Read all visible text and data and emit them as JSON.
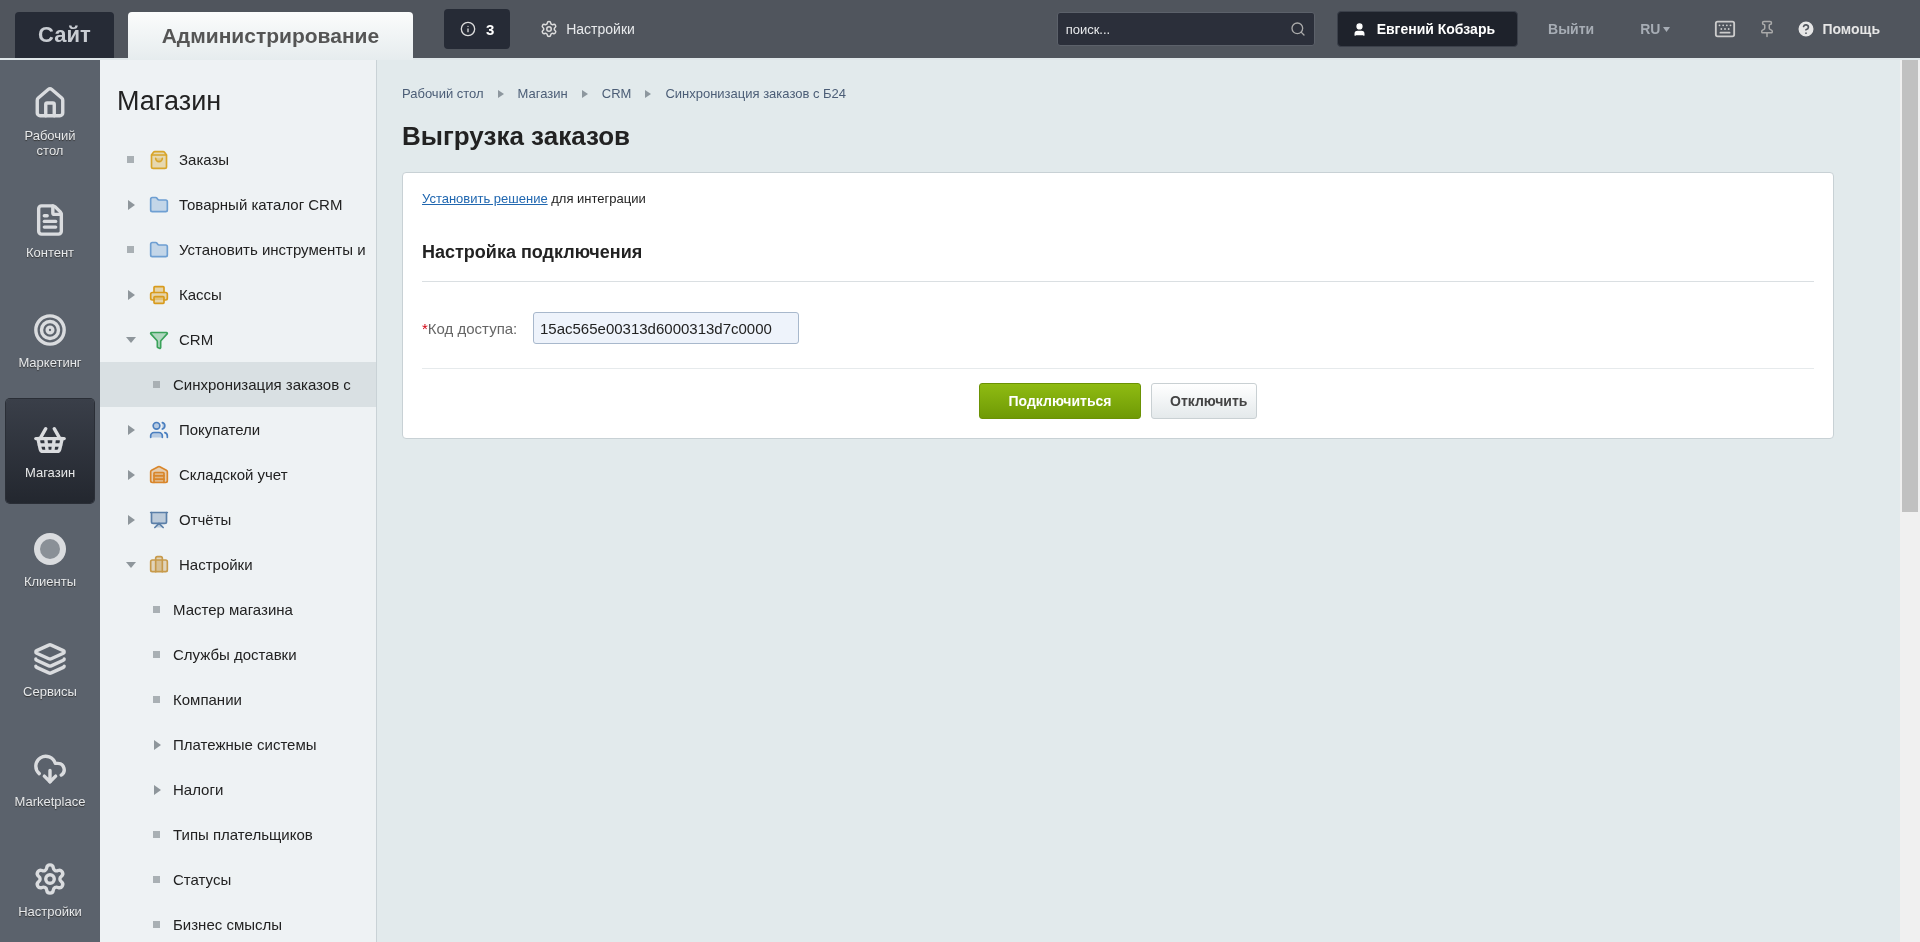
{
  "top_bar": {
    "tabs": [
      {
        "label": "Сайт",
        "selected": false
      },
      {
        "label": "Администрирование",
        "selected": true
      }
    ],
    "notifications": "3",
    "settings": "Настройки",
    "search": {
      "placeholder": "поиск..."
    },
    "user": "Евгений Кобзарь",
    "logout": "Выйти",
    "language": "RU",
    "help": "Помощь"
  },
  "rail": [
    {
      "label": "Рабочий стол",
      "selected": false
    },
    {
      "label": "Контент",
      "selected": false
    },
    {
      "label": "Маркетинг",
      "selected": false
    },
    {
      "label": "Магазин",
      "selected": true
    },
    {
      "label": "Клиенты",
      "selected": false
    },
    {
      "label": "Сервисы",
      "selected": false
    },
    {
      "label": "Marketplace",
      "selected": false
    },
    {
      "label": "Настройки",
      "selected": false
    }
  ],
  "sidebar": {
    "title": "Магазин",
    "items": [
      {
        "label": "Заказы",
        "kind": "leaf",
        "selected": false
      },
      {
        "label": "Товарный каталог CRM",
        "kind": "branch",
        "expanded": false,
        "selected": false
      },
      {
        "label": "Установить инструменты и",
        "kind": "leaf",
        "selected": false
      },
      {
        "label": "Кассы",
        "kind": "branch",
        "expanded": false,
        "selected": false
      },
      {
        "label": "CRM",
        "kind": "branch",
        "expanded": true,
        "selected": false,
        "children": [
          {
            "label": "Синхронизация заказов с",
            "kind": "leaf",
            "selected": true
          }
        ]
      },
      {
        "label": "Покупатели",
        "kind": "branch",
        "expanded": false,
        "selected": false
      },
      {
        "label": "Складской учет",
        "kind": "branch",
        "expanded": false,
        "selected": false
      },
      {
        "label": "Отчёты",
        "kind": "branch",
        "expanded": false,
        "selected": false
      },
      {
        "label": "Настройки",
        "kind": "branch",
        "expanded": true,
        "selected": false,
        "children": [
          {
            "label": "Мастер магазина",
            "kind": "leaf",
            "selected": false
          },
          {
            "label": "Службы доставки",
            "kind": "leaf",
            "selected": false
          },
          {
            "label": "Компании",
            "kind": "leaf",
            "selected": false
          },
          {
            "label": "Платежные системы",
            "kind": "branch",
            "expanded": false,
            "selected": false
          },
          {
            "label": "Налоги",
            "kind": "branch",
            "expanded": false,
            "selected": false
          },
          {
            "label": "Типы плательщиков",
            "kind": "leaf",
            "selected": false
          },
          {
            "label": "Статусы",
            "kind": "leaf",
            "selected": false
          },
          {
            "label": "Бизнес смыслы",
            "kind": "leaf",
            "selected": false
          }
        ]
      }
    ]
  },
  "breadcrumbs": [
    "Рабочий стол",
    "Магазин",
    "CRM",
    "Синхронизация заказов с Б24"
  ],
  "page_title": "Выгрузка заказов",
  "card": {
    "intro": {
      "link": "Установить решение",
      "text": " для интеграции"
    },
    "section_title": "Настройка подключения",
    "field": {
      "required_mark": "*",
      "label": "Код доступа:",
      "value": "15ac565e00313d6000313d7c0000"
    },
    "buttons": [
      {
        "label": "Подключиться",
        "kind": "primary"
      },
      {
        "label": "Отключить",
        "kind": "secondary"
      }
    ]
  }
}
